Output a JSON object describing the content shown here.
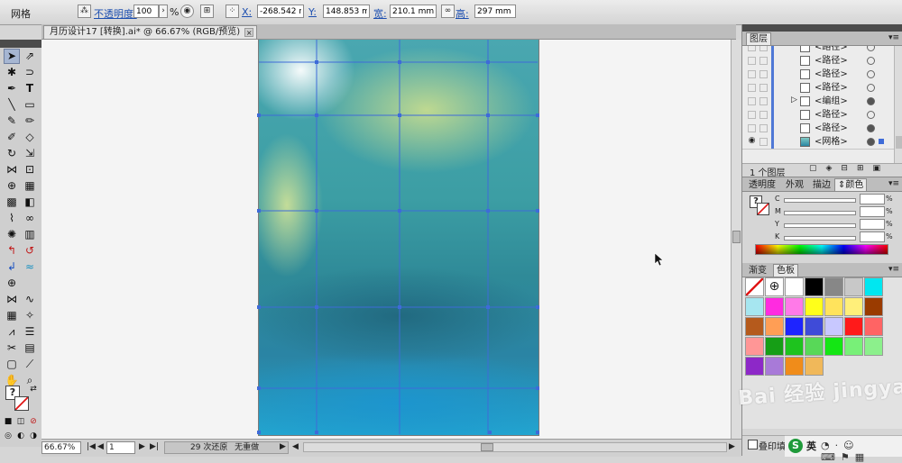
{
  "control_bar": {
    "mode_label": "网格",
    "opacity_label": "不透明度:",
    "opacity_value": "100",
    "opacity_unit": "%",
    "x_label": "X:",
    "x_value": "-268.542 mm",
    "y_label": "Y:",
    "y_value": "148.853 mm",
    "w_label": "宽:",
    "w_value": "210.1 mm",
    "h_label": "高:",
    "h_value": "297 mm"
  },
  "document": {
    "tab_title": "月历设计17 [转换].ai* @ 66.67% (RGB/预览)",
    "close_glyph": "×"
  },
  "status_bar": {
    "zoom": "66.67%",
    "artboard": "1",
    "undo_info": "29 次还原",
    "redo_info": "无重做"
  },
  "layers_panel": {
    "tab": "图层",
    "items": [
      {
        "name": "<路径>"
      },
      {
        "name": "<路径>"
      },
      {
        "name": "<路径>"
      },
      {
        "name": "<路径>"
      },
      {
        "name": "<编组>"
      },
      {
        "name": "<路径>"
      },
      {
        "name": "<路径>"
      },
      {
        "name": "<网格>"
      }
    ],
    "footer": "1 个图层"
  },
  "color_panel": {
    "tabs": [
      "透明度",
      "外观",
      "描边",
      "颜色"
    ],
    "active_tab": "颜色",
    "channels": [
      "C",
      "M",
      "Y",
      "K"
    ],
    "unit": "%",
    "unknown_glyph": "?"
  },
  "swatches_panel": {
    "tabs": [
      "渐变",
      "色板"
    ],
    "active_tab": "色板",
    "colors": [
      "#ffffff",
      "#000000",
      "#878787",
      "#c8c8c8",
      "#00e7f0",
      "#a6e6f0",
      "#ff2be0",
      "#ff7ae8",
      "#ffff1a",
      "#ffe35c",
      "#ffef7a",
      "#9a3b00",
      "#b55a1c",
      "#ff9e55",
      "#1e24ff",
      "#3f4bd8",
      "#c8c8ff",
      "#ff1a1a",
      "#ff6464",
      "#ff9696",
      "#169e16",
      "#1ec31e",
      "#58d858",
      "#14e614",
      "#78f078",
      "#8cf08c",
      "#8d28c8",
      "#a87ad8",
      "#f08c1a",
      "#f0b85a"
    ],
    "overprint_label": "叠印填"
  },
  "watermark": {
    "text": "Bai 经验 jingyan.baidu.com"
  },
  "taskbar": {
    "ime_label": "英"
  }
}
